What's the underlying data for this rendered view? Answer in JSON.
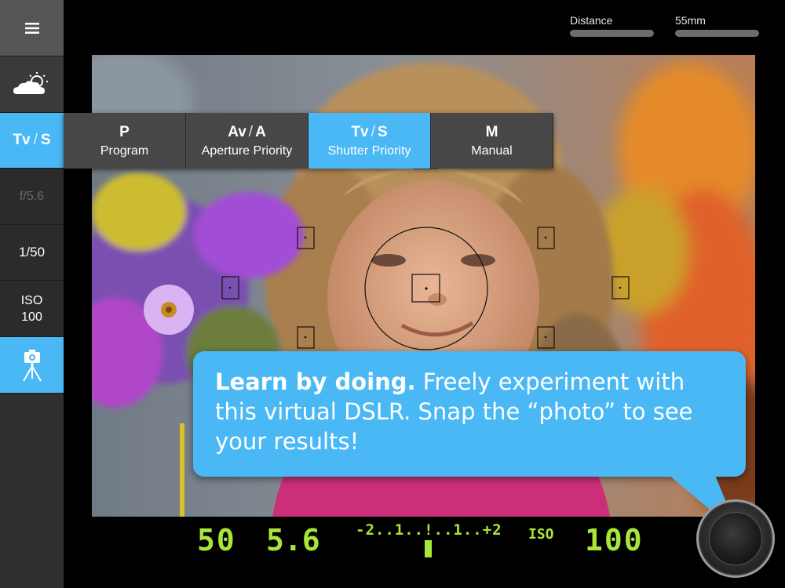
{
  "sidebar": {
    "mode": {
      "primary": "Tv",
      "secondary": "S"
    },
    "aperture": "f/5.6",
    "shutter": "1/50",
    "iso_label": "ISO",
    "iso_value": "100"
  },
  "sliders": [
    {
      "label": "Distance"
    },
    {
      "label": "55mm"
    }
  ],
  "mode_menu": [
    {
      "code": "P",
      "code2": "",
      "name": "Program",
      "active": false
    },
    {
      "code": "Av",
      "code2": "A",
      "name": "Aperture Priority",
      "active": false
    },
    {
      "code": "Tv",
      "code2": "S",
      "name": "Shutter Priority",
      "active": true
    },
    {
      "code": "M",
      "code2": "",
      "name": "Manual",
      "active": false
    }
  ],
  "bubble": {
    "bold": "Learn by doing.",
    "text": " Freely experiment with this virtual DSLR. Snap the “photo” to see your results!"
  },
  "readout": {
    "shutter": "50",
    "aperture": "5.6",
    "meter": "-2..1..!..1..+2",
    "iso_label": "ISO",
    "iso_value": "100"
  },
  "colors": {
    "accent": "#4ab8f5",
    "lcd": "#a8e63a",
    "sidebar": "#2b2b2b"
  },
  "icons": [
    "menu-icon",
    "partly-cloudy-icon",
    "tripod-camera-icon",
    "shutter-release-icon"
  ]
}
